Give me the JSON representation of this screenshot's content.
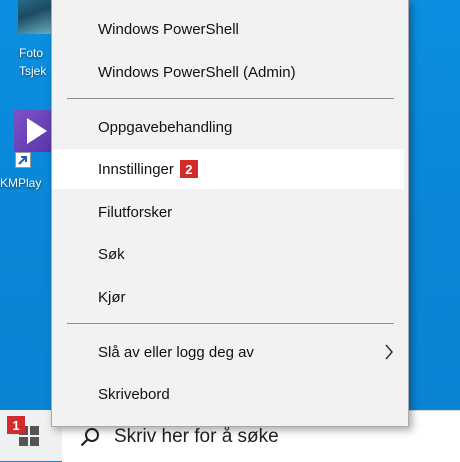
{
  "desktop": {
    "icons": [
      {
        "label_line1": "Foto",
        "label_line2": "Tsjek"
      },
      {
        "label": "KMPlay"
      }
    ]
  },
  "menu": {
    "items": [
      {
        "label": "Windows PowerShell"
      },
      {
        "label": "Windows PowerShell (Admin)"
      },
      {
        "label": "Oppgavebehandling"
      },
      {
        "label": "Innstillinger",
        "badge": "2"
      },
      {
        "label": "Filutforsker"
      },
      {
        "label": "Søk"
      },
      {
        "label": "Kjør"
      },
      {
        "label": "Slå av eller logg deg av",
        "has_submenu": true
      },
      {
        "label": "Skrivebord"
      }
    ]
  },
  "taskbar": {
    "start_badge": "1",
    "search_placeholder": "Skriv her for å søke"
  },
  "colors": {
    "desktop": "#0a88d9",
    "menu_bg": "#f2f2f2",
    "badge": "#d12b2b"
  }
}
